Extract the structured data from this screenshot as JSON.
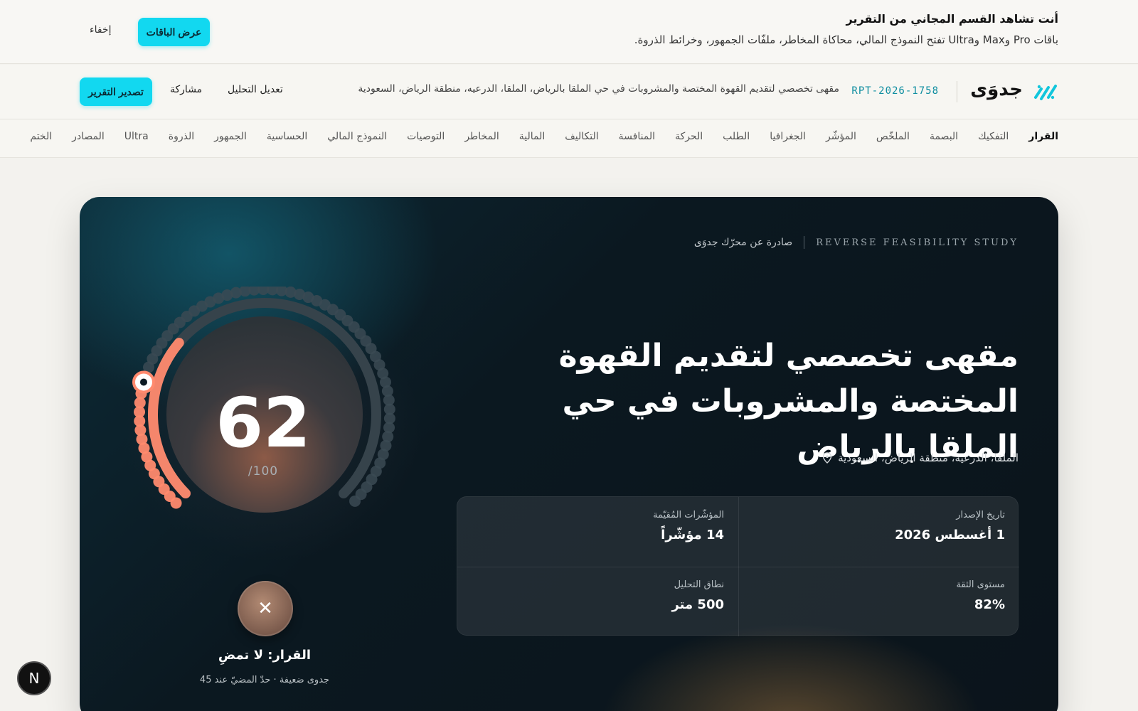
{
  "promo": {
    "title": "أنت تشاهد القسم المجاني من التقرير",
    "subtitle": "باقات Pro وMax وUltra تفتح النموذج المالي، محاكاة المخاطر، ملفّات الجمهور، وخرائط الذروة.",
    "cta_label": "عرض الباقات",
    "hide_label": "إخفاء"
  },
  "header": {
    "brand": "جدوَى",
    "report_id": "RPT-2026-1758",
    "report_name": "مقهى تخصصي لتقديم القهوة المختصة والمشروبات في حي الملقا بالرياض، الملقا، الدرعيه، منطقة الرياض، السعودية",
    "edit_label": "تعديل التحليل",
    "share_label": "مشاركة",
    "export_label": "تصدير التقرير"
  },
  "nav": {
    "items": [
      "القرار",
      "التفكيك",
      "البصمة",
      "الملخّص",
      "المؤشّر",
      "الجغرافيا",
      "الطلب",
      "الحركة",
      "المنافسة",
      "التكاليف",
      "المالية",
      "المخاطر",
      "التوصيات",
      "النموذج المالي",
      "الحساسية",
      "الجمهور",
      "الذروة",
      "Ultra",
      "المصادر",
      "الختم"
    ],
    "active_index": 0
  },
  "hero": {
    "eyebrow_en": "REVERSE FEASIBILITY STUDY",
    "eyebrow_ar": "صادرة عن محرّك جدوَى",
    "title": "مقهى تخصصي لتقديم القهوة المختصة والمشروبات في حي الملقا بالرياض",
    "location": "الملقا، الدرعيه، منطقة الرياض، السعودية",
    "stats": [
      {
        "label": "تاريخ الإصدار",
        "value": "1 أغسطس 2026"
      },
      {
        "label": "المؤشّرات المُقيّمة",
        "value": "14 مؤشّراً"
      },
      {
        "label": "مستوى الثقة",
        "value": "82%"
      },
      {
        "label": "نطاق التحليل",
        "value": "500 متر"
      }
    ],
    "score": "62",
    "score_max": "/100",
    "score_value": 62,
    "decision": "القرار: لا تمضِ",
    "decision_sub": "جدوى ضعيفة · حدّ المضيّ عند 45",
    "accent_color": "#ff8a6e",
    "accent_cyan": "#12d8f0"
  },
  "dev_badge": "N"
}
